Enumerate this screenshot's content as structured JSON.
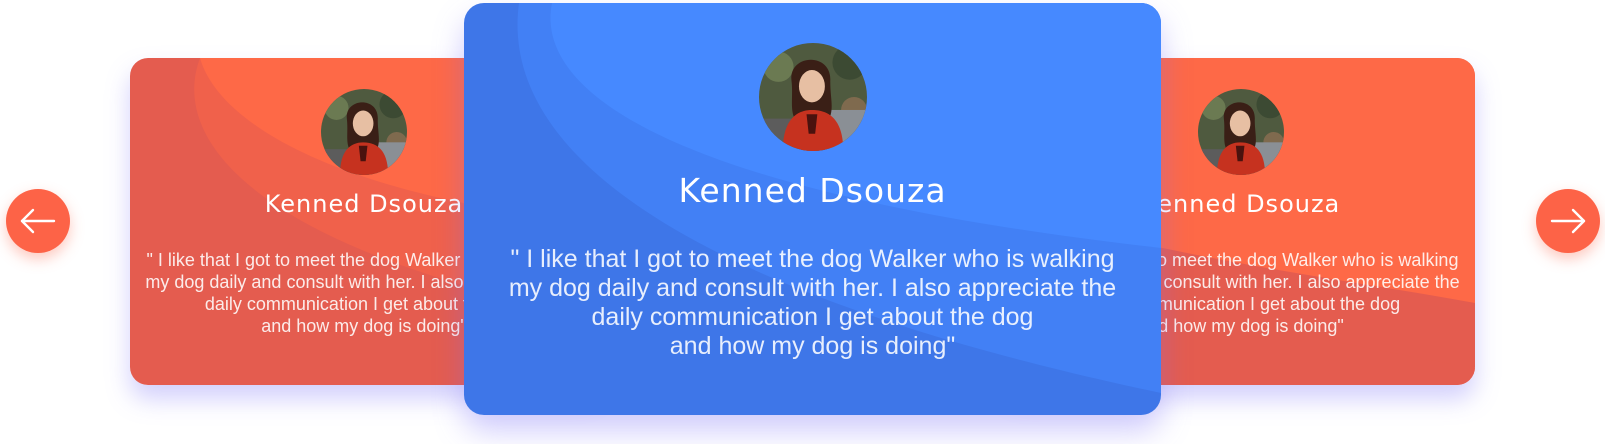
{
  "carousel": {
    "prev_icon": "arrow-left-icon",
    "next_icon": "arrow-right-icon",
    "colors": {
      "arrow_button": "#fd6347",
      "side_card_light": "#fe6947",
      "side_card_dark": "#e45c4f",
      "center_card_light": "#4689ff",
      "center_card_dark": "#3e76e8"
    },
    "slides": [
      {
        "name": "Kenned Dsouza",
        "quote": "\" I like that I got to meet the dog Walker who is walking\nmy dog daily and consult with her. I also appreciate the\ndaily communication I get about the dog\nand how my dog is doing\""
      },
      {
        "name": "Kenned Dsouza",
        "quote": "\" I like that I got to meet the dog Walker who is walking\nmy dog daily and consult with her. I also appreciate the\ndaily communication I get about the dog\nand how my dog is doing\""
      },
      {
        "name": "Kenned Dsouza",
        "quote": "\" I like that I got to meet the dog Walker who is walking\nmy dog daily and consult with her. I also appreciate the\ndaily communication I get about the dog\nand how my dog is doing\""
      }
    ]
  }
}
